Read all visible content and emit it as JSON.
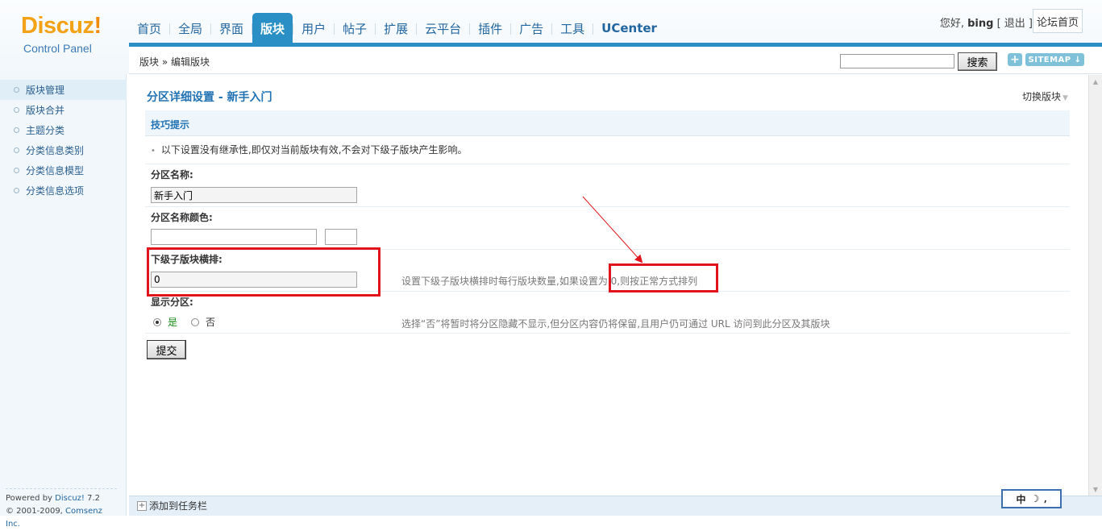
{
  "logo": {
    "brand": "Discuz",
    "exclaim": "!",
    "subtitle": "Control Panel"
  },
  "topnav": [
    "首页",
    "全局",
    "界面",
    "版块",
    "用户",
    "帖子",
    "扩展",
    "云平台",
    "插件",
    "广告",
    "工具",
    "UCenter"
  ],
  "topnav_active": "版块",
  "user": {
    "greeting": "您好,",
    "name": "bing",
    "logout": "[ 退出 ]",
    "forum_home": "论坛首页"
  },
  "breadcrumb": {
    "root": "版块",
    "sep": "»",
    "current": "编辑版块"
  },
  "search": {
    "value": "",
    "button": "搜索",
    "plus": "+",
    "sitemap": "SITEMAP ↓"
  },
  "sidebar": {
    "items": [
      "版块管理",
      "版块合并",
      "主题分类",
      "分类信息类别",
      "分类信息模型",
      "分类信息选项"
    ],
    "active_index": 0,
    "powered_prefix": "Powered by ",
    "powered_brand": "Discuz!",
    "powered_version": " 7.2",
    "copyright_prefix": "© 2001-2009, ",
    "copyright_company": "Comsenz Inc."
  },
  "main": {
    "title": "分区详细设置 - 新手入门",
    "switch_board": "切换版块",
    "switch_caret": "▼",
    "tips_title": "技巧提示",
    "tip_bullet": "•",
    "tip": "以下设置没有继承性,即仅对当前版块有效,不会对下级子版块产生影响。",
    "fields": {
      "name_label": "分区名称:",
      "name_value": "新手入门",
      "color_label": "分区名称颜色:",
      "color_value": "",
      "color_swatch": "",
      "columns_label": "下级子版块横排:",
      "columns_value": "0",
      "columns_hint": "设置下级子版块横排时每行版块数量,如果设置为 0,则按正常方式排列",
      "show_label": "显示分区:",
      "show_yes": "是",
      "show_no": "否",
      "show_selected": "是",
      "show_hint": "选择“否”将暂时将分区隐藏不显示,但分区内容仍将保留,且用户仍可通过 URL 访问到此分区及其版块"
    },
    "submit": "提交"
  },
  "footer": {
    "add_taskbar_icon": "+",
    "add_taskbar": "添加到任务栏"
  },
  "ime": {
    "mode": "中",
    "moon": "☽",
    "punct": "⸴"
  },
  "colors": {
    "accent": "#2a8fc4",
    "link": "#2266a0",
    "annotation": "#e0141a",
    "logo": "#f2a214"
  }
}
